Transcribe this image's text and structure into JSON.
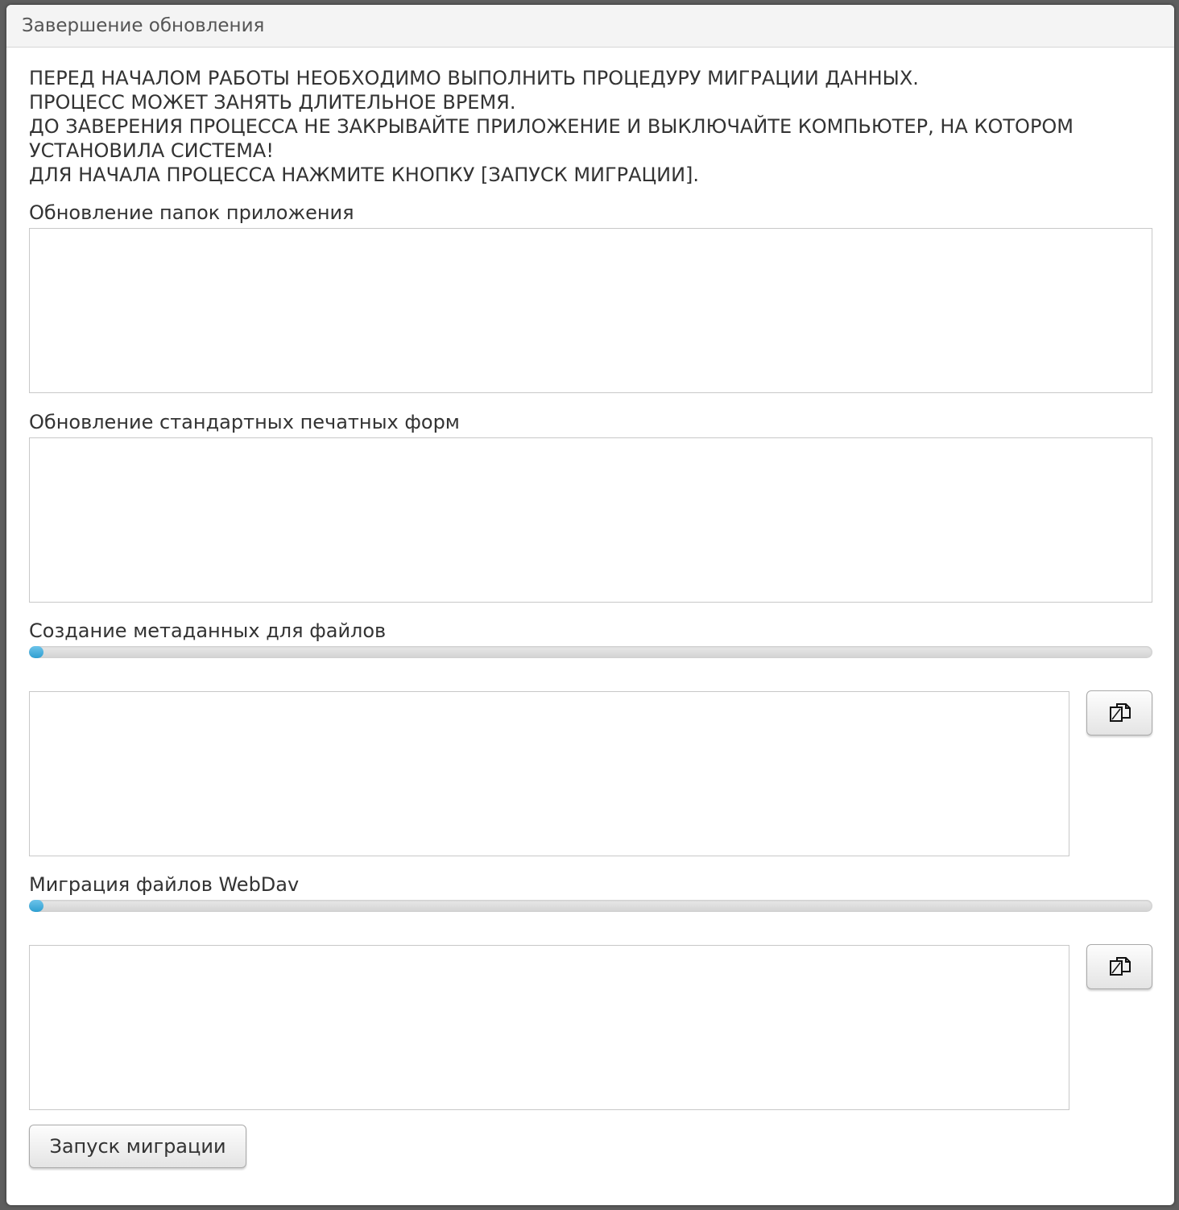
{
  "dialog": {
    "title": "Завершение обновления"
  },
  "notice": {
    "lines": [
      "ПЕРЕД НАЧАЛОМ РАБОТЫ НЕОБХОДИМО ВЫПОЛНИТЬ ПРОЦЕДУРУ МИГРАЦИИ ДАННЫХ.",
      "ПРОЦЕСС МОЖЕТ ЗАНЯТЬ ДЛИТЕЛЬНОЕ ВРЕМЯ.",
      "ДО ЗАВЕРЕНИЯ ПРОЦЕССА НЕ ЗАКРЫВАЙТЕ ПРИЛОЖЕНИЕ И ВЫКЛЮЧАЙТЕ КОМПЬЮТЕР, НА КОТОРОМ",
      "УСТАНОВИЛА СИСТЕМА!",
      "ДЛЯ НАЧАЛА ПРОЦЕССА НАЖМИТЕ КНОПКУ [ЗАПУСК МИГРАЦИИ]."
    ]
  },
  "sections": {
    "app_folders": {
      "label": "Обновление папок приложения",
      "log": ""
    },
    "print_forms": {
      "label": "Обновление стандартных печатных форм",
      "log": ""
    },
    "file_metadata": {
      "label": "Создание метаданных для файлов",
      "progress_percent": 0,
      "log": "",
      "copy_icon": "copy-icon"
    },
    "webdav_migration": {
      "label": "Миграция файлов WebDav",
      "progress_percent": 0,
      "log": "",
      "copy_icon": "copy-icon"
    }
  },
  "actions": {
    "start_label": "Запуск миграции"
  },
  "colors": {
    "progress_fill": "#3aa6d8",
    "progress_track": "#dcdcdc",
    "title_bar": "#f4f4f4"
  }
}
